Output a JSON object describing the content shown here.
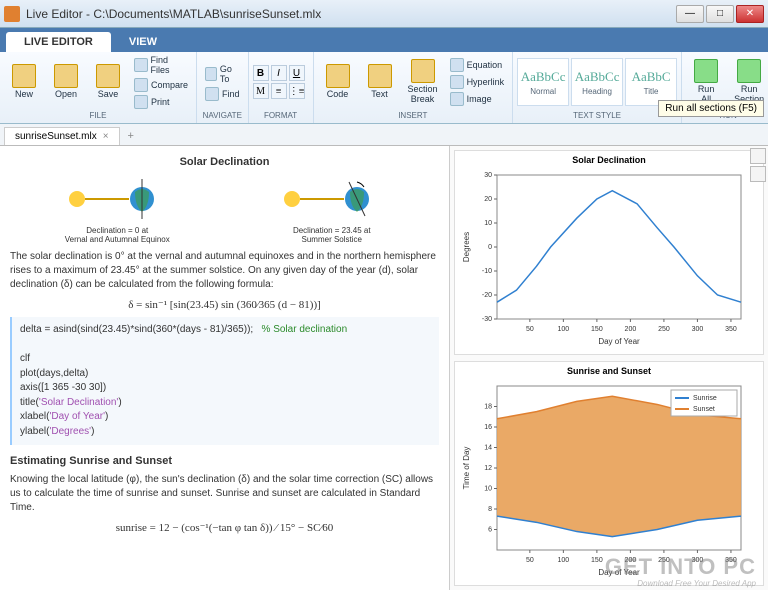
{
  "window": {
    "title": "Live Editor - C:\\Documents\\MATLAB\\sunriseSunset.mlx",
    "min": "—",
    "max": "□",
    "close": "✕"
  },
  "tabs": {
    "live_editor": "LIVE EDITOR",
    "view": "VIEW"
  },
  "ribbon": {
    "file": {
      "new": "New",
      "open": "Open",
      "save": "Save",
      "find_files": "Find Files",
      "compare": "Compare",
      "print": "Print",
      "label": "FILE"
    },
    "nav": {
      "goto": "Go To",
      "find": "Find",
      "label": "NAVIGATE"
    },
    "format": {
      "label": "FORMAT"
    },
    "insert": {
      "code": "Code",
      "text": "Text",
      "section_break": "Section\nBreak",
      "equation": "Equation",
      "hyperlink": "Hyperlink",
      "image": "Image",
      "label": "INSERT"
    },
    "styles": {
      "normal": "Normal",
      "heading": "Heading",
      "title": "Title",
      "sample": "AaBbCc",
      "sample_title": "AaBbC",
      "label": "TEXT STYLE"
    },
    "run": {
      "run_all": "Run All",
      "run_section": "Run\nSection",
      "label": "RUN"
    },
    "tooltip": "Run all sections (F5)"
  },
  "doc_tab": {
    "name": "sunriseSunset.mlx",
    "close": "×",
    "add": "+"
  },
  "content": {
    "title1": "Solar Declination",
    "diag1_caption": "Declination = 0 at\nVernal and Autumnal Equinox",
    "diag2_caption": "Declination = 23.45 at\nSummer Solstice",
    "para1": "The solar declination is 0° at the vernal and autumnal equinoxes and in the northern hemisphere rises to a maximum of 23.45° at the summer solstice. On any given day of the year (d), solar declination (δ) can be calculated from the following formula:",
    "formula1": "δ = sin⁻¹ [sin(23.45) sin (360⁄365 (d − 81))]",
    "code": "delta = asind(sind(23.45)*sind(360*(days - 81)/365));   % Solar declination\n\nclf\nplot(days,delta)\naxis([1 365 -30 30])\ntitle('Solar Declination')\nxlabel('Day of Year')\nylabel('Degrees')",
    "title2": "Estimating Sunrise and Sunset",
    "para2": "Knowing the local latitude (φ), the sun's declination (δ) and the solar time correction (SC) allows us to calculate the time of sunrise and sunset. Sunrise and sunset are calculated in Standard Time.",
    "formula2": "sunrise = 12 − (cos⁻¹(−tan φ tan δ)) ⁄ 15° − SC⁄60"
  },
  "chart_data": [
    {
      "type": "line",
      "title": "Solar Declination",
      "xlabel": "Day of Year",
      "ylabel": "Degrees",
      "xlim": [
        1,
        365
      ],
      "ylim": [
        -30,
        30
      ],
      "xticks": [
        50,
        100,
        150,
        200,
        250,
        300,
        350
      ],
      "yticks": [
        -30,
        -20,
        -10,
        0,
        10,
        20,
        30
      ],
      "series": [
        {
          "name": "delta",
          "color": "#3080d0",
          "x": [
            1,
            30,
            60,
            81,
            120,
            150,
            173,
            210,
            240,
            265,
            300,
            330,
            365
          ],
          "y": [
            -23,
            -18,
            -8,
            0,
            12,
            20,
            23.45,
            18,
            8,
            0,
            -12,
            -20,
            -23
          ]
        }
      ]
    },
    {
      "type": "area",
      "title": "Sunrise and Sunset",
      "xlabel": "Day of Year",
      "ylabel": "Time of Day",
      "xlim": [
        1,
        365
      ],
      "ylim": [
        4,
        20
      ],
      "xticks": [
        50,
        100,
        150,
        200,
        250,
        300,
        350
      ],
      "yticks": [
        6,
        8,
        10,
        12,
        14,
        16,
        18
      ],
      "legend": [
        "Sunrise",
        "Sunset"
      ],
      "series": [
        {
          "name": "Sunrise",
          "color": "#3080d0",
          "x": [
            1,
            60,
            120,
            173,
            240,
            300,
            365
          ],
          "y": [
            7.3,
            6.7,
            5.8,
            5.3,
            6.0,
            6.9,
            7.3
          ]
        },
        {
          "name": "Sunset",
          "color": "#e08030",
          "fill": "#e8a055",
          "x": [
            1,
            60,
            120,
            173,
            240,
            300,
            365
          ],
          "y": [
            16.8,
            17.5,
            18.5,
            19.0,
            18.2,
            17.2,
            16.8
          ]
        }
      ]
    }
  ],
  "watermark": {
    "main": "GET INTO PC",
    "sub": "Download Free Your Desired App"
  }
}
